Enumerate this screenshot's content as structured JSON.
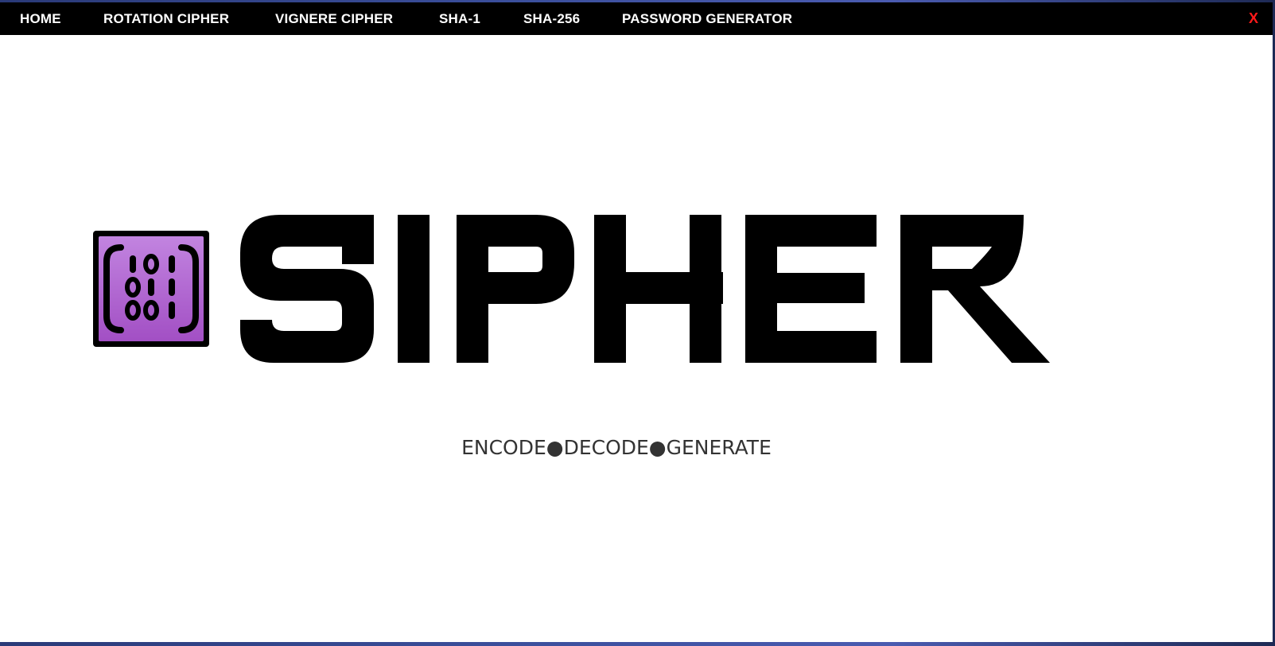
{
  "nav": {
    "items": [
      {
        "label": "HOME"
      },
      {
        "label": "ROTATION CIPHER"
      },
      {
        "label": "VIGNERE CIPHER"
      },
      {
        "label": "SHA-1"
      },
      {
        "label": "SHA-256"
      },
      {
        "label": "PASSWORD GENERATOR"
      }
    ],
    "close_label": "X"
  },
  "logo": {
    "icon": "binary-code-icon",
    "icon_digits": [
      "101",
      "011",
      "001"
    ],
    "wordmark": "SIPHER",
    "icon_color": "#b46ad0"
  },
  "tagline": "ENCODE●DECODE●GENERATE",
  "colors": {
    "navbar_bg": "#000000",
    "nav_text": "#ffffff",
    "close": "#ff1a1a",
    "accent_purple": "#b46ad0"
  }
}
